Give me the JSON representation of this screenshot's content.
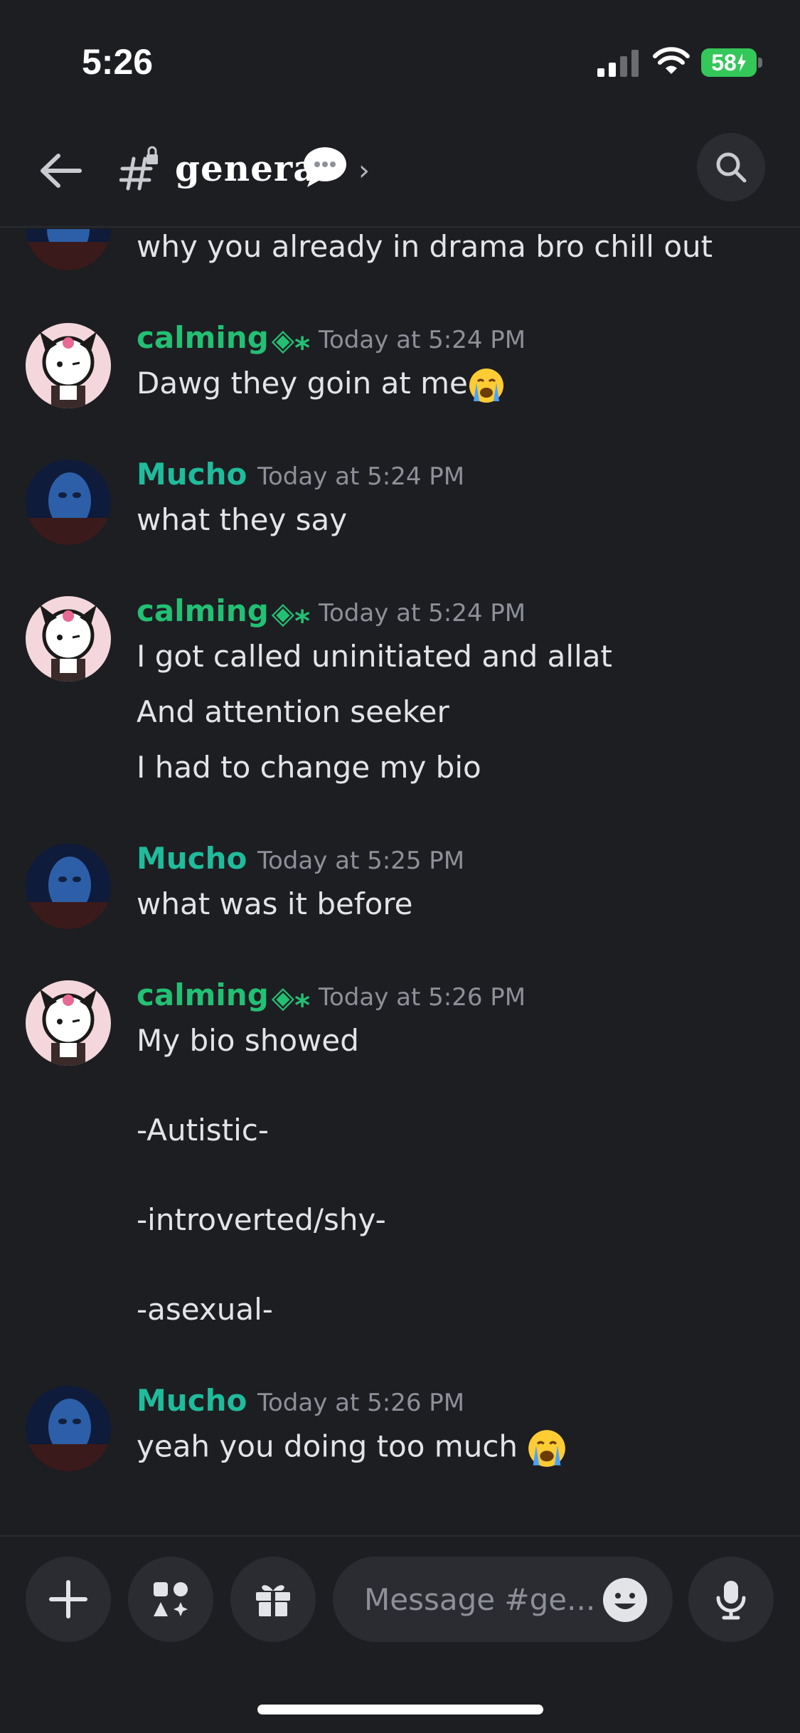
{
  "status_bar": {
    "time": "5:26",
    "battery": "58"
  },
  "header": {
    "channel_name": "general",
    "chevron": "›"
  },
  "messages": [
    {
      "type": "continuation",
      "text": "why you already in drama bro chill out"
    },
    {
      "author": "calming",
      "badge": "◈⁎",
      "timestamp": "Today at 5:24 PM",
      "lines": [
        "Dawg they goin at me"
      ]
    },
    {
      "author": "Mucho",
      "timestamp": "Today at 5:24 PM",
      "lines": [
        "what they say"
      ]
    },
    {
      "author": "calming",
      "badge": "◈⁎",
      "timestamp": "Today at 5:24 PM",
      "lines": [
        "I got called uninitiated and allat",
        "And attention seeker",
        "I had to change my bio"
      ]
    },
    {
      "author": "Mucho",
      "timestamp": "Today at 5:25 PM",
      "lines": [
        "what was it before"
      ]
    },
    {
      "author": "calming",
      "badge": "◈⁎",
      "timestamp": "Today at 5:26 PM",
      "lines": [
        "My bio showed",
        "-Autistic-",
        "-introverted/shy-",
        "-asexual-"
      ]
    },
    {
      "author": "Mucho",
      "timestamp": "Today at 5:26 PM",
      "lines": [
        "yeah you doing too much "
      ]
    }
  ],
  "composer": {
    "placeholder": "Message #ge..."
  },
  "colors": {
    "background": "#1d1e22",
    "calming_name": "#23c074",
    "mucho_name": "#1fbc9c",
    "timestamp": "#8e9099",
    "battery": "#34c759"
  },
  "icons": [
    "back-arrow-icon",
    "channel-hash-icon",
    "speech-bubble-icon",
    "search-icon",
    "plus-icon",
    "apps-icon",
    "gift-icon",
    "emoji-icon",
    "microphone-icon",
    "loudly-crying-face-icon"
  ]
}
